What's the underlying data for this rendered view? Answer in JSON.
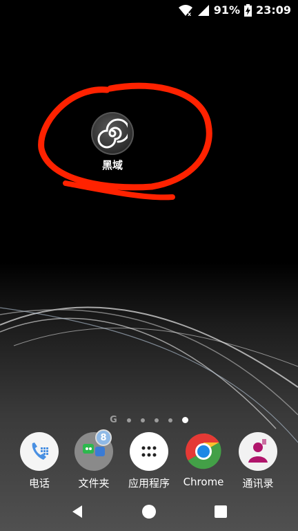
{
  "status_bar": {
    "battery_percent": "91%",
    "time": "23:09",
    "icons": [
      "wifi-icon",
      "signal-icon",
      "battery-charging-icon"
    ]
  },
  "home": {
    "app": {
      "label": "黑域",
      "icon": "spiral-icon"
    },
    "annotation_color": "#ff2200"
  },
  "page_indicator": {
    "google_label": "G",
    "pages": 5,
    "active_page": 5
  },
  "dock": {
    "items": [
      {
        "label": "电话",
        "icon": "phone-icon"
      },
      {
        "label": "文件夹",
        "icon": "folder-icon",
        "badge": "8"
      },
      {
        "label": "应用程序",
        "icon": "app-drawer-icon"
      },
      {
        "label": "Chrome",
        "icon": "chrome-icon"
      },
      {
        "label": "通讯录",
        "icon": "contacts-icon"
      }
    ]
  },
  "nav_bar": {
    "buttons": [
      "back-icon",
      "home-icon",
      "recents-icon"
    ]
  }
}
